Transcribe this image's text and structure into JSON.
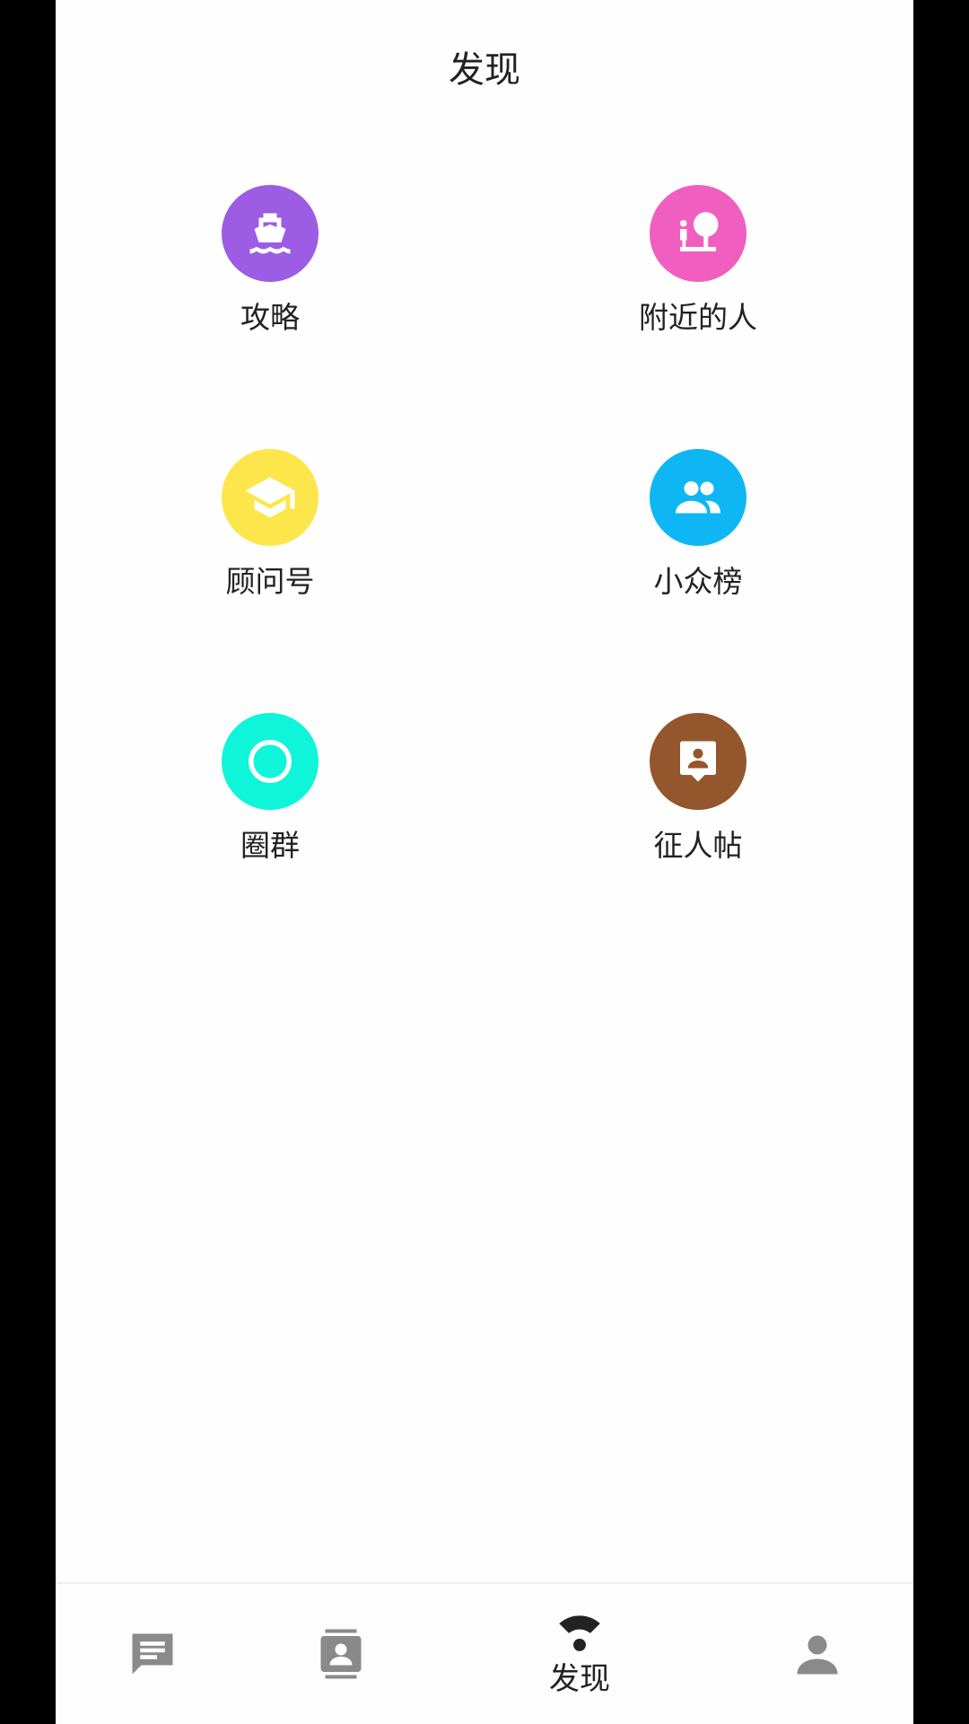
{
  "header": {
    "title": "发现"
  },
  "grid": {
    "items": [
      {
        "label": "攻略",
        "icon": "ship-icon",
        "color": "#9c5ce4"
      },
      {
        "label": "附近的人",
        "icon": "nearby-person-icon",
        "color": "#f05fbf"
      },
      {
        "label": "顾问号",
        "icon": "graduation-cap-icon",
        "color": "#fde64b"
      },
      {
        "label": "小众榜",
        "icon": "group-icon",
        "color": "#0eb7f3"
      },
      {
        "label": "圈群",
        "icon": "circle-icon",
        "color": "#0ef5d9"
      },
      {
        "label": "征人帖",
        "icon": "person-badge-icon",
        "color": "#94562c"
      }
    ]
  },
  "tabbar": {
    "tabs": [
      {
        "icon": "chat-icon",
        "label": ""
      },
      {
        "icon": "contacts-icon",
        "label": ""
      },
      {
        "icon": "discover-icon",
        "label": "发现",
        "active": true
      },
      {
        "icon": "profile-icon",
        "label": ""
      }
    ],
    "inactive_color": "#8a8a8a",
    "active_color": "#222222"
  }
}
